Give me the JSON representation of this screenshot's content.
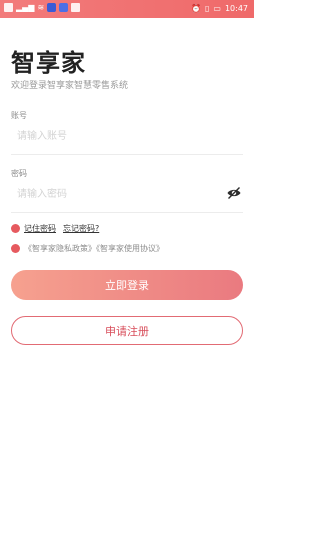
{
  "status_bar": {
    "time": "10:47",
    "signal_text": "⁴ᴳ",
    "battery_percent_text": ""
  },
  "header": {
    "app_title": "智享家",
    "subtitle": "欢迎登录智享家智慧零售系统"
  },
  "account": {
    "label": "账号",
    "placeholder": "请输入账号",
    "value": ""
  },
  "password": {
    "label": "密码",
    "placeholder": "请输入密码",
    "value": ""
  },
  "options": {
    "remember": "记住密码",
    "forgot": "忘记密码?"
  },
  "agreement": {
    "text": "《智享家隐私政策》《智享家使用协议》"
  },
  "buttons": {
    "login": "立即登录",
    "register": "申请注册"
  },
  "colors": {
    "accent": "#e65a5f",
    "status_bar": "#f27b7b",
    "login_gradient_start": "#f6a18f",
    "login_gradient_end": "#ea7a80"
  }
}
